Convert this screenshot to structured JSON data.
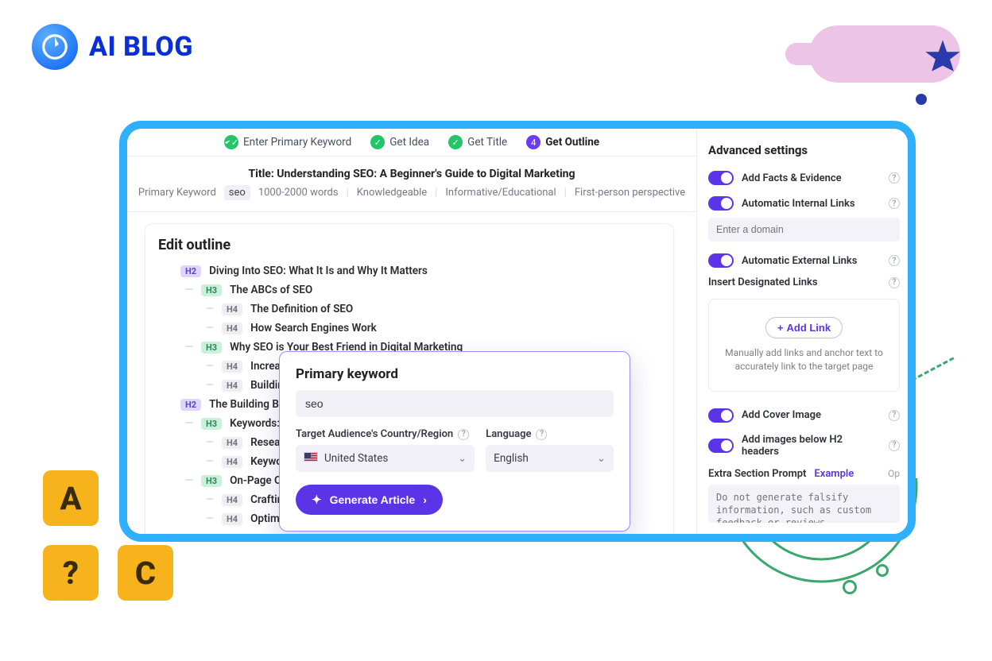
{
  "brand": {
    "text": "AI BLOG"
  },
  "tiles": {
    "a": "A",
    "q": "?",
    "c": "C"
  },
  "steps": [
    {
      "label": "Enter Primary Keyword",
      "status": "done"
    },
    {
      "label": "Get Idea",
      "status": "done"
    },
    {
      "label": "Get Title",
      "status": "done"
    },
    {
      "label": "Get Outline",
      "status": "current",
      "num": "4"
    }
  ],
  "title_prefix": "Title: ",
  "title": "Understanding SEO: A Beginner's Guide to Digital Marketing",
  "meta": {
    "primary_label": "Primary Keyword",
    "keyword": "seo",
    "length": "1000-2000 words",
    "expertise": "Knowledgeable",
    "tone": "Informative/Educational",
    "perspective": "First-person perspective"
  },
  "outline": {
    "heading": "Edit outline",
    "items": [
      {
        "lvl": "h2",
        "text": "Diving Into SEO: What It Is and Why It Matters"
      },
      {
        "lvl": "h3",
        "text": "The ABCs of SEO"
      },
      {
        "lvl": "h4",
        "text": "The Definition of SEO"
      },
      {
        "lvl": "h4",
        "text": "How Search Engines Work"
      },
      {
        "lvl": "h3",
        "text": "Why SEO is Your Best Friend in Digital Marketing"
      },
      {
        "lvl": "h4",
        "text": "Increasing Vi"
      },
      {
        "lvl": "h4",
        "text": "Building Trus"
      },
      {
        "lvl": "h2",
        "text": "The Building Blocks o"
      },
      {
        "lvl": "h3",
        "text": "Keywords: The F"
      },
      {
        "lvl": "h4",
        "text": "Researching"
      },
      {
        "lvl": "h4",
        "text": "Keyword Plac"
      },
      {
        "lvl": "h3",
        "text": "On-Page Optimi"
      },
      {
        "lvl": "h4",
        "text": "Crafting Qual"
      },
      {
        "lvl": "h4",
        "text": "Optimizing Pa"
      }
    ]
  },
  "popover": {
    "title": "Primary keyword",
    "keyword_value": "seo",
    "country_label": "Target Audience's Country/Region",
    "country_value": "United States",
    "lang_label": "Language",
    "lang_value": "English",
    "button": "Generate Article"
  },
  "sidebar": {
    "heading": "Advanced settings",
    "facts": "Add Facts & Evidence",
    "internal": "Automatic Internal Links",
    "domain_placeholder": "Enter a domain",
    "external": "Automatic External Links",
    "insert_links": "Insert Designated Links",
    "add_link": "Add Link",
    "links_hint": "Manually add links and anchor text to accurately link to the target page",
    "cover": "Add Cover Image",
    "below_h2": "Add images below H2 headers",
    "extra_label": "Extra Section Prompt",
    "example": "Example",
    "optional": "Op",
    "extra_placeholder": "Do not generate falsify information, such as custom feedback or reviews"
  }
}
